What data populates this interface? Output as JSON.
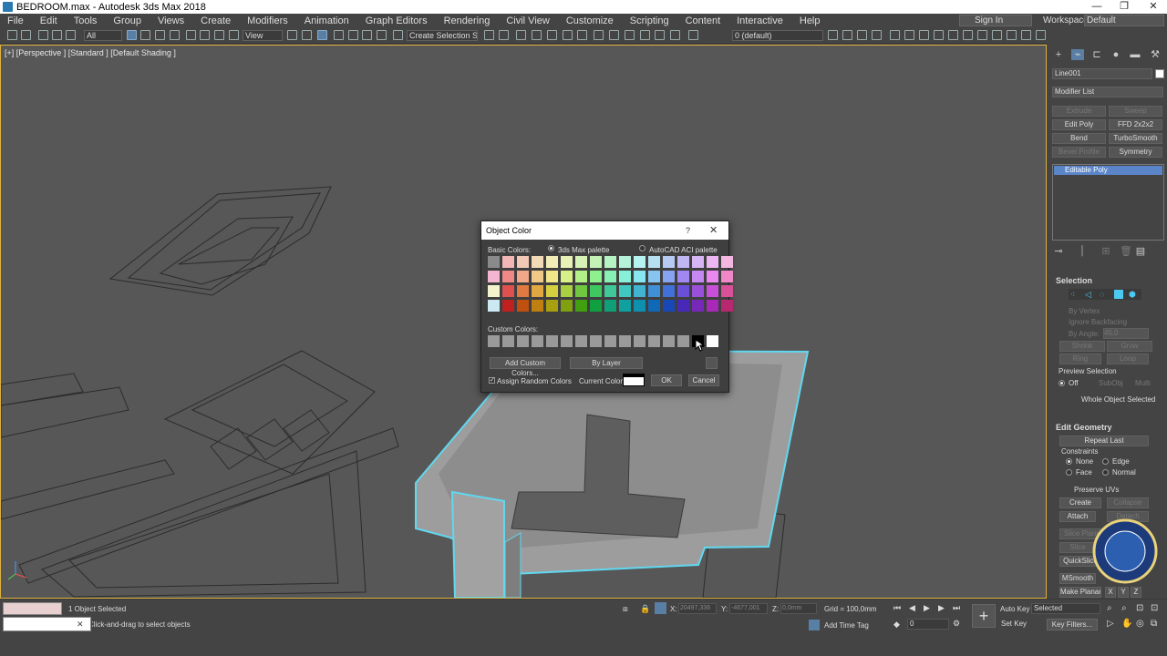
{
  "title_bar": {
    "title": "BEDROOM.max - Autodesk 3ds Max 2018"
  },
  "menu": [
    "File",
    "Edit",
    "Tools",
    "Group",
    "Views",
    "Create",
    "Modifiers",
    "Animation",
    "Graph Editors",
    "Rendering",
    "Civil View",
    "Customize",
    "Scripting",
    "Content",
    "Interactive",
    "Help"
  ],
  "account": {
    "signin": "Sign In",
    "workspace_label": "Workspaces:",
    "workspace_value": "Default"
  },
  "toolbar": {
    "filter": "All",
    "refcoord": "View",
    "selection_set": "Create Selection Se",
    "layer": "0 (default)"
  },
  "viewport": {
    "label": "[+] [Perspective ] [Standard ] [Default Shading ]"
  },
  "command_panel": {
    "object_name": "Line001",
    "modifier_list": "Modifier List",
    "modifier_buttons": [
      {
        "label": "Extrude",
        "enabled": false
      },
      {
        "label": "Sweep",
        "enabled": false
      },
      {
        "label": "Edit Poly",
        "enabled": true
      },
      {
        "label": "FFD 2x2x2",
        "enabled": true
      },
      {
        "label": "Bend",
        "enabled": true
      },
      {
        "label": "TurboSmooth",
        "enabled": true
      },
      {
        "label": "Bevel Profile",
        "enabled": false
      },
      {
        "label": "Symmetry",
        "enabled": true
      }
    ],
    "stack_item": "Editable Poly",
    "selection": {
      "title": "Selection",
      "by_vertex": "By Vertex",
      "ignore_backfacing": "Ignore Backfacing",
      "by_angle": "By Angle:",
      "angle_value": "45,0",
      "shrink": "Shrink",
      "grow": "Grow",
      "ring": "Ring",
      "loop": "Loop",
      "preview_label": "Preview Selection",
      "preview_off": "Off",
      "preview_subobj": "SubObj",
      "preview_multi": "Multi",
      "status": "Whole Object Selected"
    },
    "edit_geometry": {
      "title": "Edit Geometry",
      "repeat_last": "Repeat Last",
      "constraints": "Constraints",
      "none": "None",
      "edge": "Edge",
      "face": "Face",
      "normal": "Normal",
      "preserve_uvs": "Preserve UVs",
      "create": "Create",
      "collapse": "Collapse",
      "attach": "Attach",
      "detach": "Detach",
      "slice_plane": "Slice Plane",
      "slice": "Slice",
      "quickslice": "QuickSlice",
      "msmooth": "MSmooth",
      "make_planar": "Make Planar",
      "x": "X",
      "y": "Y",
      "z": "Z"
    }
  },
  "dialog": {
    "title": "Object Color",
    "help": "?",
    "close": "✕",
    "basic_colors_label": "Basic Colors:",
    "palette_3dsmax": "3ds Max palette",
    "palette_autocad": "AutoCAD ACI palette",
    "custom_colors_label": "Custom Colors:",
    "add_custom": "Add Custom Colors...",
    "by_layer": "By Layer",
    "assign_random": "Assign Random Colors",
    "current_color_label": "Current Color:",
    "ok": "OK",
    "cancel": "Cancel",
    "current_color": "#ffffff",
    "basic_colors": [
      [
        "#8a8a8a",
        "#f2b6b6",
        "#f2c8b6",
        "#f2dab6",
        "#f2ecb6",
        "#e8f2b6",
        "#d6f2b6",
        "#c4f2b6",
        "#b6f2c4",
        "#b6f2da",
        "#b6f2f0",
        "#b6e0f2",
        "#b6caf2",
        "#c0b6f2",
        "#d6b6f2",
        "#ecb6f2",
        "#f2b6e0"
      ],
      [
        "#f2b6d0",
        "#f08888",
        "#f0a888",
        "#f0c888",
        "#f0e888",
        "#d8f088",
        "#b4f088",
        "#8ef08e",
        "#88f0b4",
        "#88f0d8",
        "#88e6f0",
        "#88c4f0",
        "#88a4f0",
        "#a088f0",
        "#c488f0",
        "#e888f0",
        "#f088c8"
      ],
      [
        "#f2f2cc",
        "#e05050",
        "#e07a40",
        "#e0a840",
        "#d6d040",
        "#a8d040",
        "#70c840",
        "#40c860",
        "#40c89a",
        "#40c8c0",
        "#40b4d0",
        "#4090d8",
        "#4070d8",
        "#6a50d8",
        "#9a50d8",
        "#c850d8",
        "#d85098"
      ],
      [
        "#cce8f2",
        "#c02020",
        "#c05010",
        "#c08010",
        "#a8a010",
        "#80a010",
        "#40a010",
        "#10a040",
        "#10a078",
        "#10a0a0",
        "#1090b0",
        "#1068b8",
        "#1848b8",
        "#4828b8",
        "#7828b8",
        "#a828b8",
        "#b82870"
      ]
    ],
    "custom_colors": [
      "#9a9a9a",
      "#9a9a9a",
      "#9a9a9a",
      "#9a9a9a",
      "#9a9a9a",
      "#9a9a9a",
      "#9a9a9a",
      "#9a9a9a",
      "#9a9a9a",
      "#9a9a9a",
      "#9a9a9a",
      "#9a9a9a",
      "#9a9a9a",
      "#9a9a9a",
      "#000000",
      "#ffffff"
    ]
  },
  "status": {
    "selected": "1 Object Selected",
    "prompt": "Click-and-drag to select objects",
    "coord_x_label": "X:",
    "coord_x": "20497,336",
    "coord_y_label": "Y:",
    "coord_y": "-4677,001",
    "coord_z_label": "Z:",
    "coord_z": "0,0mm",
    "grid": "Grid = 100,0mm",
    "add_time_tag": "Add Time Tag",
    "auto_key": "Auto Key",
    "set_key": "Set Key",
    "key_mode": "Selected",
    "key_filters": "Key Filters...",
    "frame": "0"
  }
}
